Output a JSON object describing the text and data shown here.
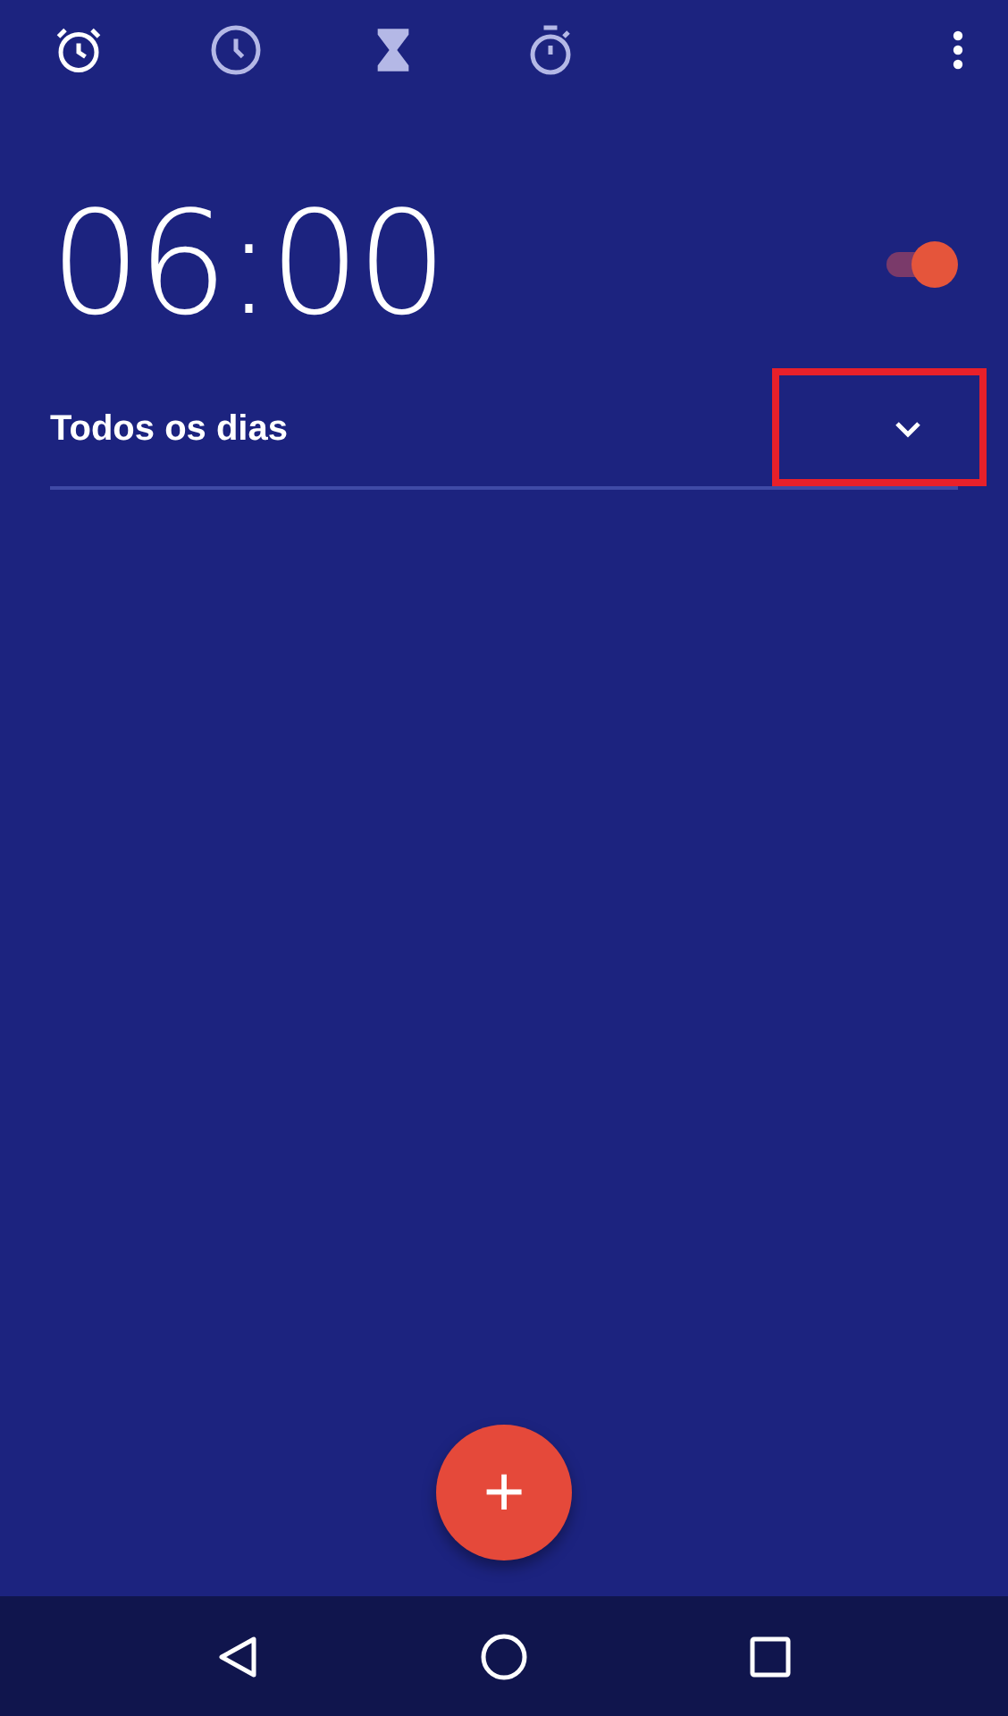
{
  "tabs": [
    {
      "kind": "alarm",
      "selected": true
    },
    {
      "kind": "clock",
      "selected": false
    },
    {
      "kind": "timer",
      "selected": false
    },
    {
      "kind": "stopwatch",
      "selected": false
    }
  ],
  "alarm": {
    "time": "06:00",
    "on": true,
    "repeat": "Todos os dias",
    "expanded": false,
    "highlighted": true
  },
  "fab": {
    "label": "+"
  }
}
